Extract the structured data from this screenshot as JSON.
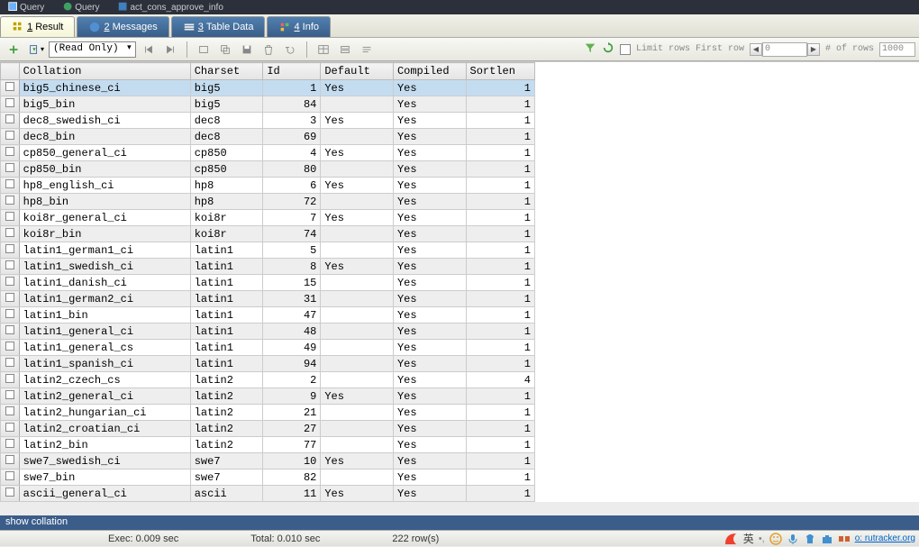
{
  "topTabs": [
    {
      "label": "Query"
    },
    {
      "label": "Query"
    },
    {
      "label": "act_cons_approve_info"
    }
  ],
  "resultTabs": [
    {
      "num": "1",
      "label": "Result",
      "active": true
    },
    {
      "num": "2",
      "label": "Messages",
      "active": false
    },
    {
      "num": "3",
      "label": "Table Data",
      "active": false
    },
    {
      "num": "4",
      "label": "Info",
      "active": false
    }
  ],
  "toolbar": {
    "modeDropdown": "(Read Only)",
    "limitRowsLabel": "Limit rows",
    "firstRowLabel": "First row",
    "firstRowValue": "0",
    "numRowsLabel": "# of rows",
    "numRowsValue": "1000"
  },
  "columns": [
    "",
    "Collation",
    "Charset",
    "Id",
    "Default",
    "Compiled",
    "Sortlen"
  ],
  "rows": [
    {
      "collation": "big5_chinese_ci",
      "charset": "big5",
      "id": 1,
      "default": "Yes",
      "compiled": "Yes",
      "sortlen": 1,
      "selected": true
    },
    {
      "collation": "big5_bin",
      "charset": "big5",
      "id": 84,
      "default": "",
      "compiled": "Yes",
      "sortlen": 1
    },
    {
      "collation": "dec8_swedish_ci",
      "charset": "dec8",
      "id": 3,
      "default": "Yes",
      "compiled": "Yes",
      "sortlen": 1
    },
    {
      "collation": "dec8_bin",
      "charset": "dec8",
      "id": 69,
      "default": "",
      "compiled": "Yes",
      "sortlen": 1
    },
    {
      "collation": "cp850_general_ci",
      "charset": "cp850",
      "id": 4,
      "default": "Yes",
      "compiled": "Yes",
      "sortlen": 1
    },
    {
      "collation": "cp850_bin",
      "charset": "cp850",
      "id": 80,
      "default": "",
      "compiled": "Yes",
      "sortlen": 1
    },
    {
      "collation": "hp8_english_ci",
      "charset": "hp8",
      "id": 6,
      "default": "Yes",
      "compiled": "Yes",
      "sortlen": 1
    },
    {
      "collation": "hp8_bin",
      "charset": "hp8",
      "id": 72,
      "default": "",
      "compiled": "Yes",
      "sortlen": 1
    },
    {
      "collation": "koi8r_general_ci",
      "charset": "koi8r",
      "id": 7,
      "default": "Yes",
      "compiled": "Yes",
      "sortlen": 1
    },
    {
      "collation": "koi8r_bin",
      "charset": "koi8r",
      "id": 74,
      "default": "",
      "compiled": "Yes",
      "sortlen": 1
    },
    {
      "collation": "latin1_german1_ci",
      "charset": "latin1",
      "id": 5,
      "default": "",
      "compiled": "Yes",
      "sortlen": 1
    },
    {
      "collation": "latin1_swedish_ci",
      "charset": "latin1",
      "id": 8,
      "default": "Yes",
      "compiled": "Yes",
      "sortlen": 1
    },
    {
      "collation": "latin1_danish_ci",
      "charset": "latin1",
      "id": 15,
      "default": "",
      "compiled": "Yes",
      "sortlen": 1
    },
    {
      "collation": "latin1_german2_ci",
      "charset": "latin1",
      "id": 31,
      "default": "",
      "compiled": "Yes",
      "sortlen": 1
    },
    {
      "collation": "latin1_bin",
      "charset": "latin1",
      "id": 47,
      "default": "",
      "compiled": "Yes",
      "sortlen": 1
    },
    {
      "collation": "latin1_general_ci",
      "charset": "latin1",
      "id": 48,
      "default": "",
      "compiled": "Yes",
      "sortlen": 1
    },
    {
      "collation": "latin1_general_cs",
      "charset": "latin1",
      "id": 49,
      "default": "",
      "compiled": "Yes",
      "sortlen": 1
    },
    {
      "collation": "latin1_spanish_ci",
      "charset": "latin1",
      "id": 94,
      "default": "",
      "compiled": "Yes",
      "sortlen": 1
    },
    {
      "collation": "latin2_czech_cs",
      "charset": "latin2",
      "id": 2,
      "default": "",
      "compiled": "Yes",
      "sortlen": 4
    },
    {
      "collation": "latin2_general_ci",
      "charset": "latin2",
      "id": 9,
      "default": "Yes",
      "compiled": "Yes",
      "sortlen": 1
    },
    {
      "collation": "latin2_hungarian_ci",
      "charset": "latin2",
      "id": 21,
      "default": "",
      "compiled": "Yes",
      "sortlen": 1
    },
    {
      "collation": "latin2_croatian_ci",
      "charset": "latin2",
      "id": 27,
      "default": "",
      "compiled": "Yes",
      "sortlen": 1
    },
    {
      "collation": "latin2_bin",
      "charset": "latin2",
      "id": 77,
      "default": "",
      "compiled": "Yes",
      "sortlen": 1
    },
    {
      "collation": "swe7_swedish_ci",
      "charset": "swe7",
      "id": 10,
      "default": "Yes",
      "compiled": "Yes",
      "sortlen": 1
    },
    {
      "collation": "swe7_bin",
      "charset": "swe7",
      "id": 82,
      "default": "",
      "compiled": "Yes",
      "sortlen": 1
    },
    {
      "collation": "ascii_general_ci",
      "charset": "ascii",
      "id": 11,
      "default": "Yes",
      "compiled": "Yes",
      "sortlen": 1
    }
  ],
  "statusBar1": "show collation",
  "statusBar2": {
    "exec": "Exec: 0.009 sec",
    "total": "Total: 0.010 sec",
    "rows": "222 row(s)"
  },
  "tray": {
    "ime": "英",
    "link": "o: rutracker.org"
  }
}
